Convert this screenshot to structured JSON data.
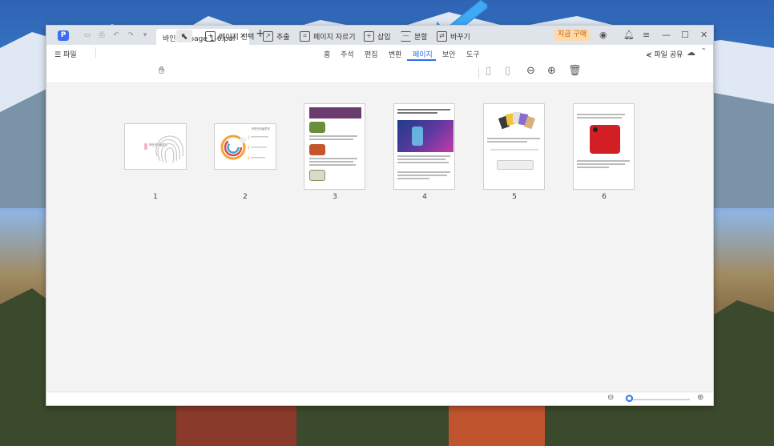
{
  "window": {
    "tab_title": "바인더1 page 1-6.pdf",
    "buy_label": "지금 구매"
  },
  "menubar": {
    "file_label": "파일",
    "tabs": [
      "홈",
      "주석",
      "편집",
      "변환",
      "페이지",
      "보안",
      "도구"
    ],
    "active_tab": "페이지",
    "share_label": "파일 공유"
  },
  "toolbar": {
    "select_page": "페이지 선택",
    "extract": "추출",
    "crop": "페이지 자르기",
    "insert": "삽입",
    "split": "분할",
    "replace": "바꾸기"
  },
  "pages": [
    {
      "number": "1",
      "caption": "보안관리솔루션"
    },
    {
      "number": "2",
      "caption": "보안관리솔루션"
    },
    {
      "number": "3",
      "caption": ""
    },
    {
      "number": "4",
      "caption": ""
    },
    {
      "number": "5",
      "caption": ""
    },
    {
      "number": "6",
      "caption": ""
    }
  ],
  "zoom": {
    "level_fraction": 0.05
  },
  "colors": {
    "accent": "#2a6ff0",
    "buy_bg": "#ffd9a8",
    "arrow": "#3fa9f5",
    "recipe_header": "#6b3d6e",
    "phone_red": "#d21f26"
  }
}
